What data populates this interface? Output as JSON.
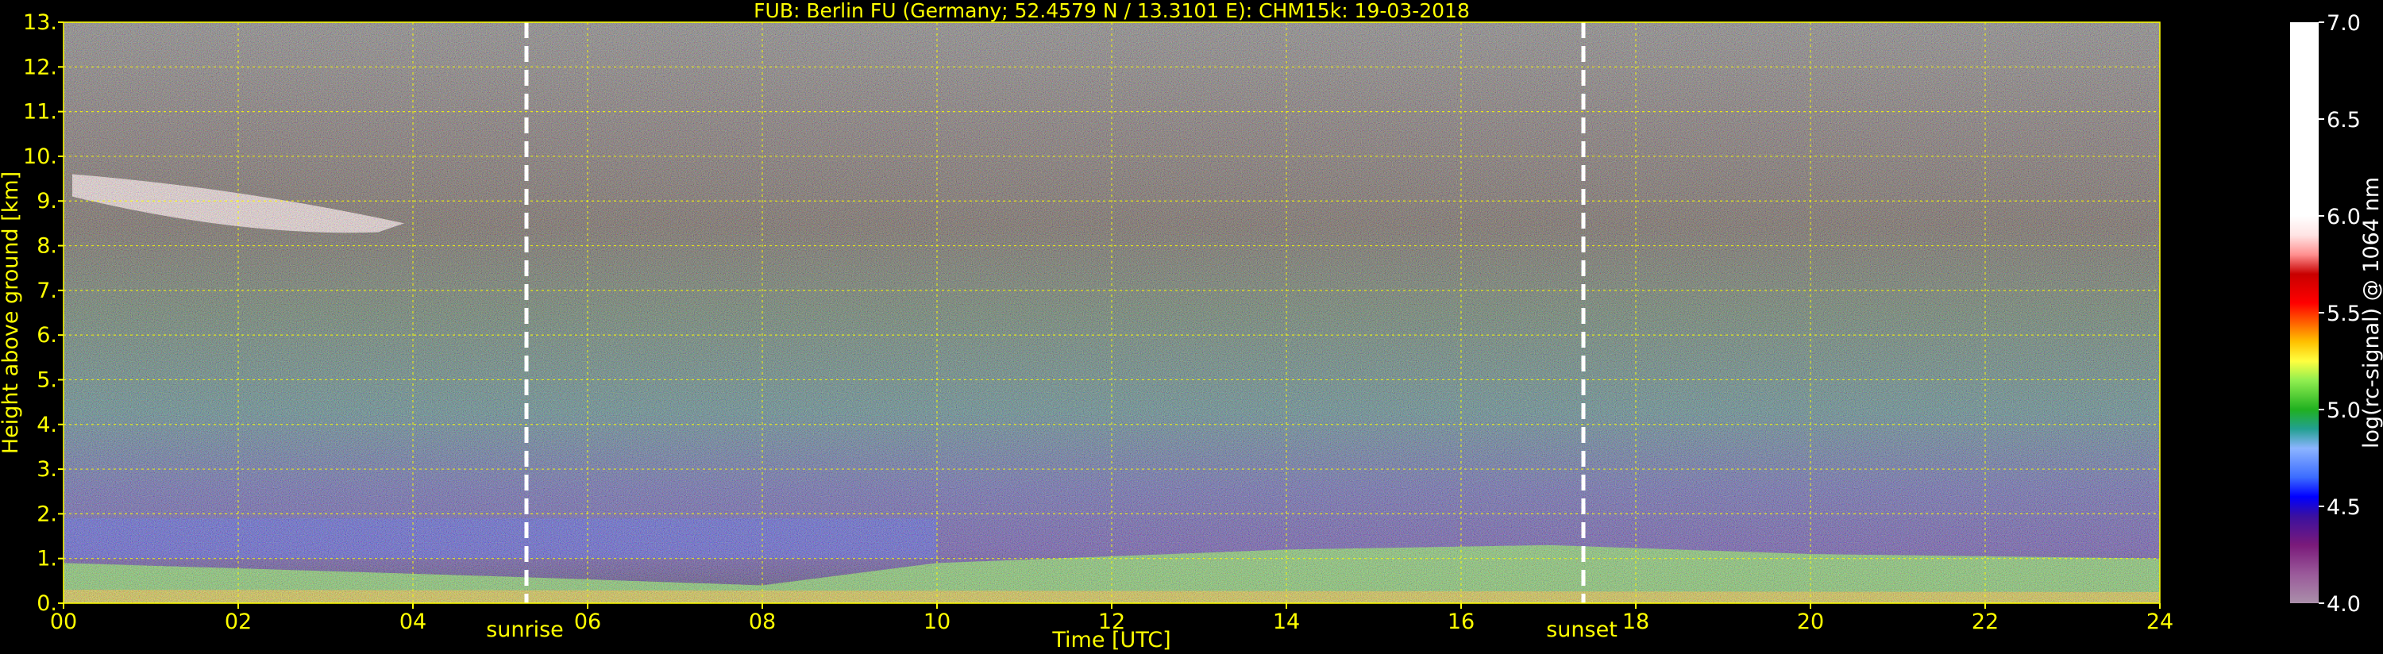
{
  "chart_data": {
    "type": "heatmap",
    "title": "FUB: Berlin FU (Germany; 52.4579 N / 13.3101 E):    CHM15k: 19-03-2018",
    "xlabel": "Time [UTC]",
    "ylabel": "Height above ground [km]",
    "xlim": [
      0,
      24
    ],
    "ylim": [
      0,
      13
    ],
    "x_ticks": [
      0,
      2,
      4,
      6,
      8,
      10,
      12,
      14,
      16,
      18,
      20,
      22,
      24
    ],
    "x_tick_labels": [
      "00",
      "02",
      "04",
      "06",
      "08",
      "10",
      "12",
      "14",
      "16",
      "18",
      "20",
      "22",
      "24"
    ],
    "y_ticks": [
      0,
      1,
      2,
      3,
      4,
      5,
      6,
      7,
      8,
      9,
      10,
      11,
      12,
      13
    ],
    "y_tick_labels": [
      "0.",
      "1.",
      "2.",
      "3.",
      "4.",
      "5.",
      "6.",
      "7.",
      "8.",
      "9.",
      "10.",
      "11.",
      "12.",
      "13."
    ],
    "grid": true,
    "grid_color": "#ffff00",
    "text_color": "#ffff00",
    "background": "#000000",
    "annotations": [
      {
        "label": "sunrise",
        "x": 5.3
      },
      {
        "label": "sunset",
        "x": 17.4
      }
    ],
    "colorbar": {
      "label": "log(rc-signal) @ 1064 nm",
      "range": [
        4.0,
        7.0
      ],
      "ticks": [
        4.0,
        4.5,
        5.0,
        5.5,
        6.0,
        6.5,
        7.0
      ],
      "tick_labels": [
        "4.0",
        "4.5",
        "5.0",
        "5.5",
        "6.0",
        "6.5",
        "7.0"
      ],
      "stops": [
        {
          "v": 4.0,
          "color": "#aa8faa"
        },
        {
          "v": 4.15,
          "color": "#9a5a9a"
        },
        {
          "v": 4.3,
          "color": "#7a1a7a"
        },
        {
          "v": 4.45,
          "color": "#3a10a0"
        },
        {
          "v": 4.55,
          "color": "#0000ff"
        },
        {
          "v": 4.65,
          "color": "#3c6cff"
        },
        {
          "v": 4.8,
          "color": "#8cb4ff"
        },
        {
          "v": 4.9,
          "color": "#22a090"
        },
        {
          "v": 5.0,
          "color": "#20b020"
        },
        {
          "v": 5.15,
          "color": "#90ee50"
        },
        {
          "v": 5.25,
          "color": "#ffff40"
        },
        {
          "v": 5.35,
          "color": "#ffc000"
        },
        {
          "v": 5.45,
          "color": "#ff6000"
        },
        {
          "v": 5.55,
          "color": "#ff0000"
        },
        {
          "v": 5.7,
          "color": "#c80000"
        },
        {
          "v": 5.8,
          "color": "#ff9090"
        },
        {
          "v": 5.9,
          "color": "#ffe4e4"
        },
        {
          "v": 6.0,
          "color": "#ffffff"
        },
        {
          "v": 7.0,
          "color": "#ffffff"
        }
      ]
    },
    "features": [
      {
        "type": "cirrus cloud",
        "time_range": [
          0.1,
          3.9
        ],
        "height_range_km": [
          8.3,
          9.6
        ],
        "level": 5.9
      },
      {
        "type": "boundary layer",
        "time_range": [
          0,
          24
        ],
        "top_height_km_by_time": [
          [
            0,
            0.9
          ],
          [
            5,
            0.6
          ],
          [
            8,
            0.4
          ],
          [
            10,
            0.9
          ],
          [
            14,
            1.2
          ],
          [
            17,
            1.3
          ],
          [
            20,
            1.1
          ],
          [
            24,
            1.0
          ]
        ],
        "level": 5.1
      },
      {
        "type": "residual layer",
        "time_range": [
          0,
          10
        ],
        "height_range_km": [
          1.0,
          1.9
        ],
        "level": 4.6
      }
    ]
  }
}
